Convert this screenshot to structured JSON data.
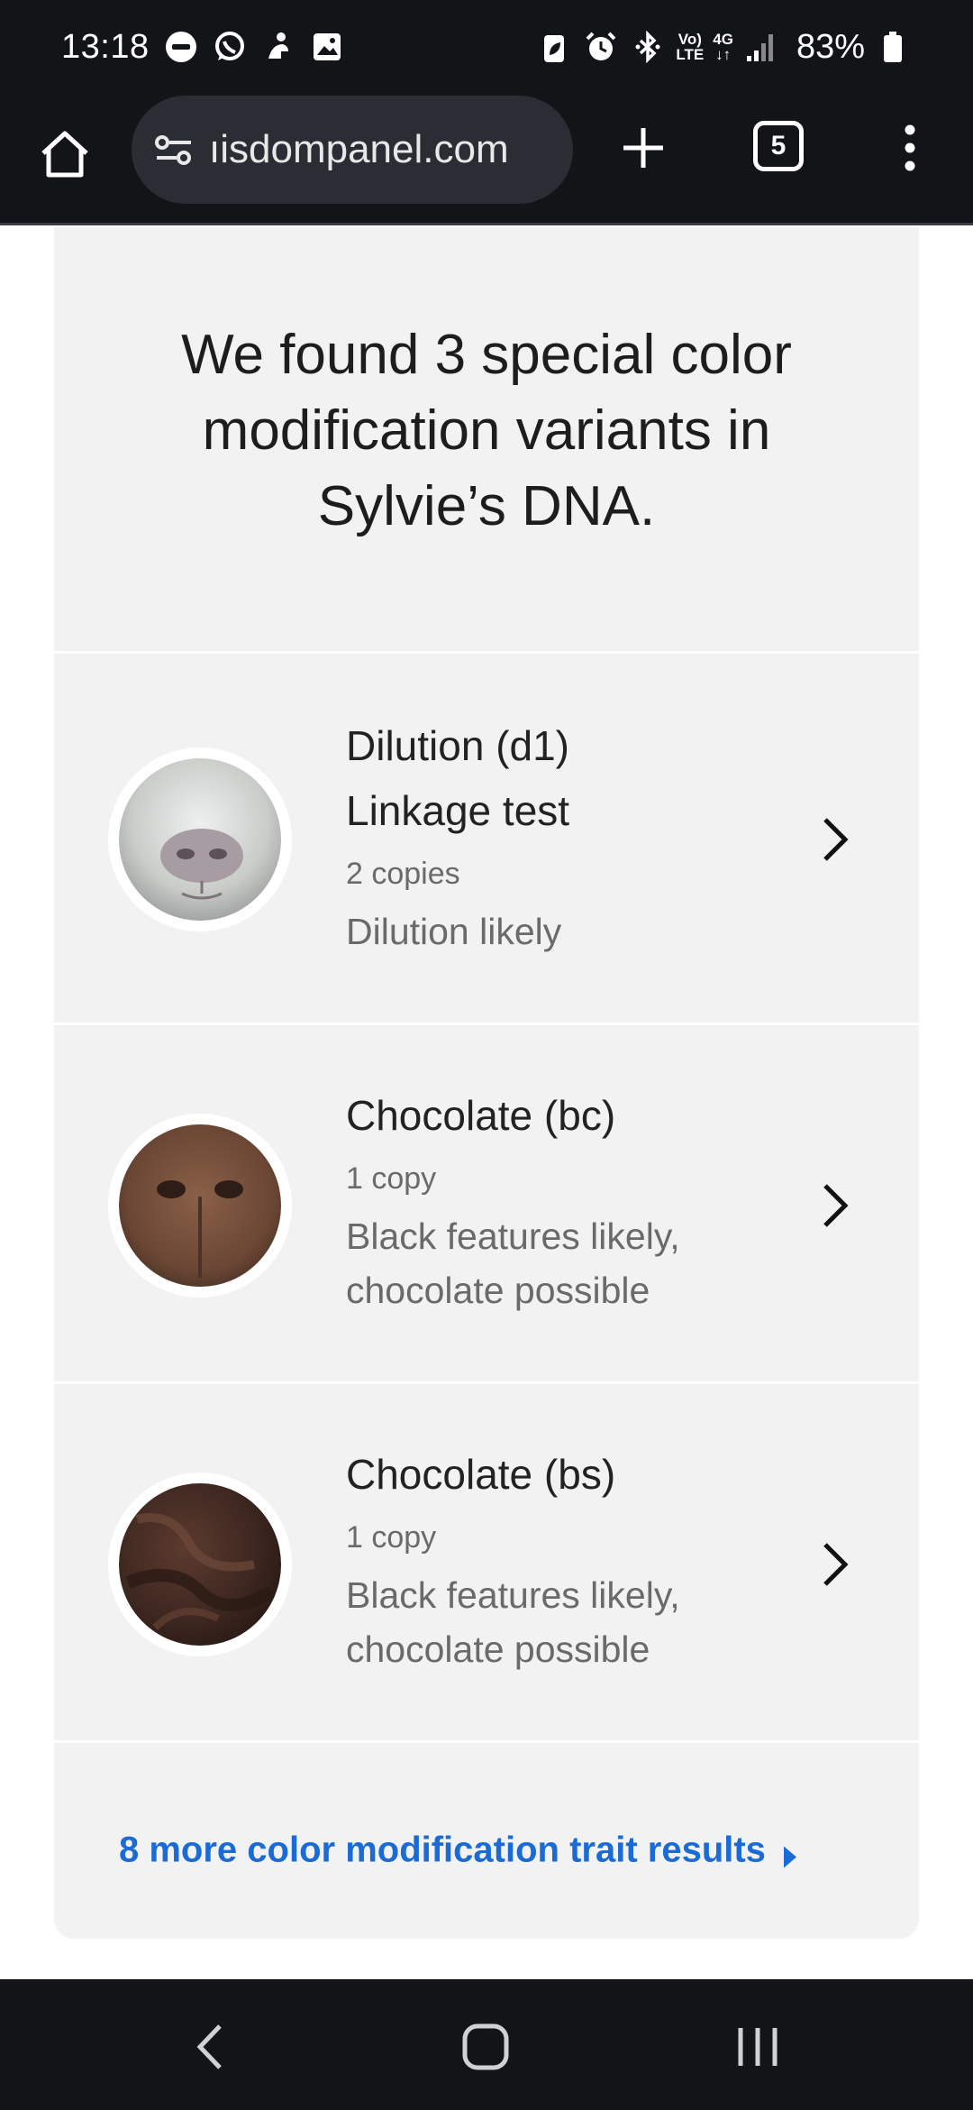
{
  "status_bar": {
    "time": "13:18",
    "battery_percent": "83%",
    "network_top": "Vo)",
    "network_bottom": "LTE",
    "network_type": "4G",
    "icons": [
      "do-not-disturb-icon",
      "whatsapp-icon",
      "notification-icon",
      "gallery-icon",
      "battery-saver-icon",
      "alarm-icon",
      "bluetooth-icon",
      "signal-icon",
      "battery-icon"
    ]
  },
  "browser": {
    "url_text": "ıisdompanel.com",
    "tab_count": "5",
    "icons": [
      "home-icon",
      "site-settings-icon",
      "new-tab-icon",
      "tab-switcher-icon",
      "more-menu-icon"
    ]
  },
  "content": {
    "headline": "We found 3 special color modification variants in Sylvie’s DNA.",
    "variants": [
      {
        "title_line1": "Dilution (d1)",
        "title_line2": "Linkage test",
        "copies": "2 copies",
        "description": "Dilution likely",
        "image": "gray-dog-nose-photo"
      },
      {
        "title_line1": "Chocolate (bc)",
        "copies": "1 copy",
        "description_line1": "Black features likely,",
        "description_line2": "chocolate possible",
        "image": "brown-dog-nose-photo"
      },
      {
        "title_line1": "Chocolate (bs)",
        "copies": "1 copy",
        "description_line1": "Black features likely,",
        "description_line2": "chocolate possible",
        "image": "chocolate-dog-fur-photo"
      }
    ],
    "more_link": "8 more color modification trait results",
    "accent_color": "#1a6bd6"
  },
  "nav_bar": {
    "icons": [
      "back-icon",
      "home-circle-icon",
      "recent-apps-icon"
    ]
  }
}
